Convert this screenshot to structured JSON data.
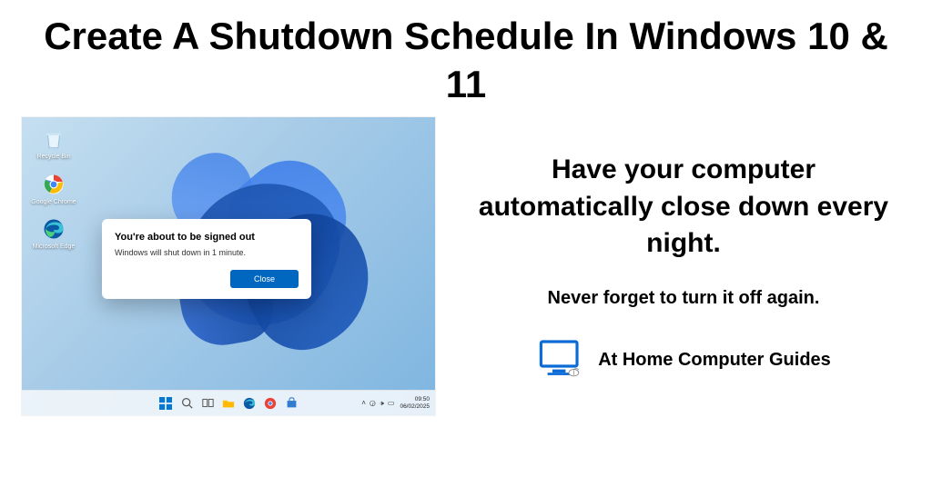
{
  "heading": "Create A Shutdown Schedule In Windows 10 & 11",
  "subtitle": "Have your computer automatically close down every night.",
  "tagline": "Never forget to turn it off again.",
  "brand": "At Home Computer Guides",
  "desktop": {
    "icons": [
      {
        "label": "Recycle Bin"
      },
      {
        "label": "Google Chrome"
      },
      {
        "label": "Microsoft Edge"
      }
    ],
    "dialog": {
      "title": "You're about to be signed out",
      "message": "Windows will shut down in 1 minute.",
      "close_label": "Close"
    },
    "taskbar": {
      "time": "09:50",
      "date": "06/02/2025"
    }
  }
}
